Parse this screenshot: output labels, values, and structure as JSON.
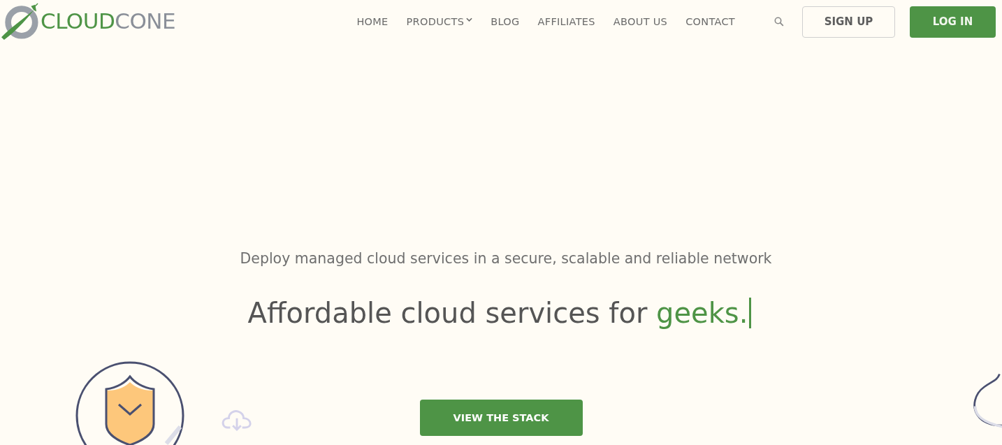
{
  "logo": {
    "prefix": "CLOUD",
    "suffix": "CONE"
  },
  "nav": [
    {
      "label": "HOME",
      "dropdown": false
    },
    {
      "label": "PRODUCTS",
      "dropdown": true
    },
    {
      "label": "BLOG",
      "dropdown": false
    },
    {
      "label": "AFFILIATES",
      "dropdown": false
    },
    {
      "label": "ABOUT US",
      "dropdown": false
    },
    {
      "label": "CONTACT",
      "dropdown": false
    }
  ],
  "buttons": [
    {
      "label": "SIGN UP",
      "kind": "outline"
    },
    {
      "label": "LOG IN",
      "kind": "primary"
    }
  ],
  "hero": {
    "subtitle": "Deploy managed cloud services in a secure, scalable and reliable network",
    "headline": "Affordable cloud services for ",
    "highlight": "geeks.",
    "cta": "VIEW THE STACK"
  }
}
